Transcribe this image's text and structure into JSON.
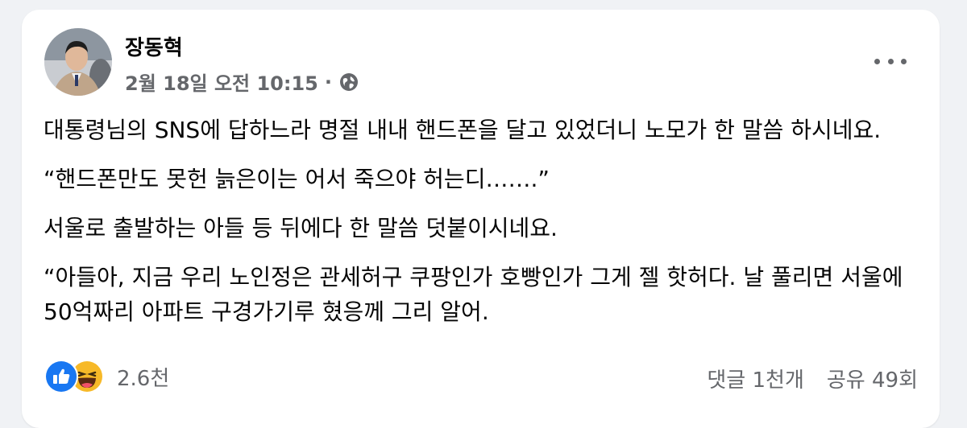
{
  "post": {
    "author": "장동혁",
    "date": "2월 18일 오전 10:15",
    "separator": "·",
    "privacy_icon": "globe-icon",
    "more_icon": "more-options-icon",
    "paragraphs": [
      "대통령님의 SNS에 답하느라 명절 내내 핸드폰을 달고 있었더니 노모가 한 말씀 하시네요.",
      "“핸드폰만도 못헌 늙은이는 어서 죽으야 허는디…….”",
      "서울로 출발하는 아들 등 뒤에다 한 말씀 덧붙이시네요.",
      "“아들아, 지금 우리 노인정은 관세허구 쿠팡인가 호빵인가 그게 젤 핫허다. 날 풀리면 서울에 50억짜리 아파트 구경가기루 혔응께 그리 알어."
    ],
    "reactions": {
      "icons": [
        "like-icon",
        "haha-icon"
      ],
      "count": "2.6천"
    },
    "comments": "댓글 1천개",
    "shares": "공유 49회"
  },
  "colors": {
    "background": "#f0f2f5",
    "card": "#ffffff",
    "secondary_text": "#65676b",
    "like_blue": "#1877f2",
    "haha_yellow": "#f7b928"
  }
}
